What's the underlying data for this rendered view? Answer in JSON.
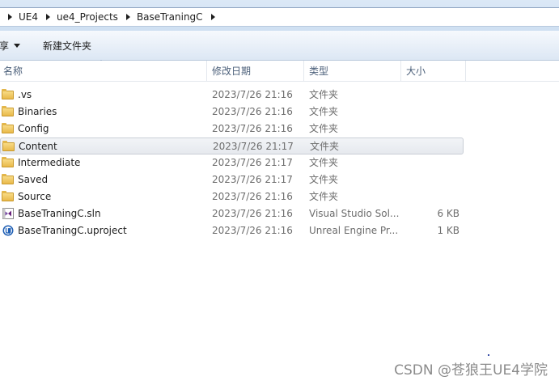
{
  "address": {
    "crumbs": [
      "UE4",
      "ue4_Projects",
      "BaseTraningC"
    ]
  },
  "toolbar": {
    "share_label": "享",
    "new_folder_label": "新建文件夹"
  },
  "columns": {
    "name": "名称",
    "date": "修改日期",
    "type": "类型",
    "size": "大小"
  },
  "files": [
    {
      "name": ".vs",
      "date": "2023/7/26 21:16",
      "type": "文件夹",
      "size": "",
      "icon": "folder-icon"
    },
    {
      "name": "Binaries",
      "date": "2023/7/26 21:16",
      "type": "文件夹",
      "size": "",
      "icon": "folder-icon"
    },
    {
      "name": "Config",
      "date": "2023/7/26 21:16",
      "type": "文件夹",
      "size": "",
      "icon": "folder-icon"
    },
    {
      "name": "Content",
      "date": "2023/7/26 21:17",
      "type": "文件夹",
      "size": "",
      "icon": "folder-icon"
    },
    {
      "name": "Intermediate",
      "date": "2023/7/26 21:17",
      "type": "文件夹",
      "size": "",
      "icon": "folder-icon"
    },
    {
      "name": "Saved",
      "date": "2023/7/26 21:17",
      "type": "文件夹",
      "size": "",
      "icon": "folder-icon"
    },
    {
      "name": "Source",
      "date": "2023/7/26 21:16",
      "type": "文件夹",
      "size": "",
      "icon": "folder-icon"
    },
    {
      "name": "BaseTraningC.sln",
      "date": "2023/7/26 21:16",
      "type": "Visual Studio Sol...",
      "size": "6 KB",
      "icon": "visual-studio-icon"
    },
    {
      "name": "BaseTraningC.uproject",
      "date": "2023/7/26 21:16",
      "type": "Unreal Engine Pr...",
      "size": "1 KB",
      "icon": "unreal-engine-icon"
    }
  ],
  "watermark": "CSDN @苍狼王UE4学院"
}
